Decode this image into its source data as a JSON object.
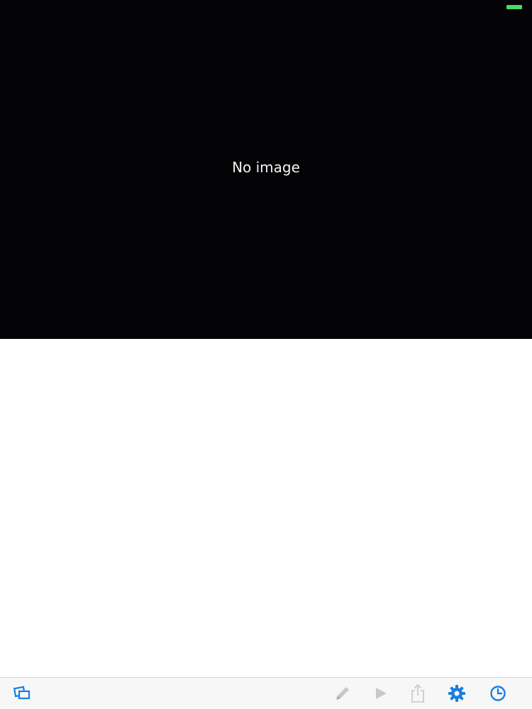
{
  "status_bar": {
    "battery_color": "#4cd964"
  },
  "preview": {
    "message": "No image",
    "background": "#030205"
  },
  "toolbar": {
    "accent_color": "#1a7fe0",
    "disabled_color": "#c7c7cc",
    "items": [
      {
        "icon": "gallery-icon",
        "enabled": true
      },
      {
        "icon": "pencil-icon",
        "enabled": false
      },
      {
        "icon": "play-icon",
        "enabled": false
      },
      {
        "icon": "share-icon",
        "enabled": false
      },
      {
        "icon": "gear-icon",
        "enabled": true
      },
      {
        "icon": "clock-icon",
        "enabled": true
      }
    ]
  }
}
